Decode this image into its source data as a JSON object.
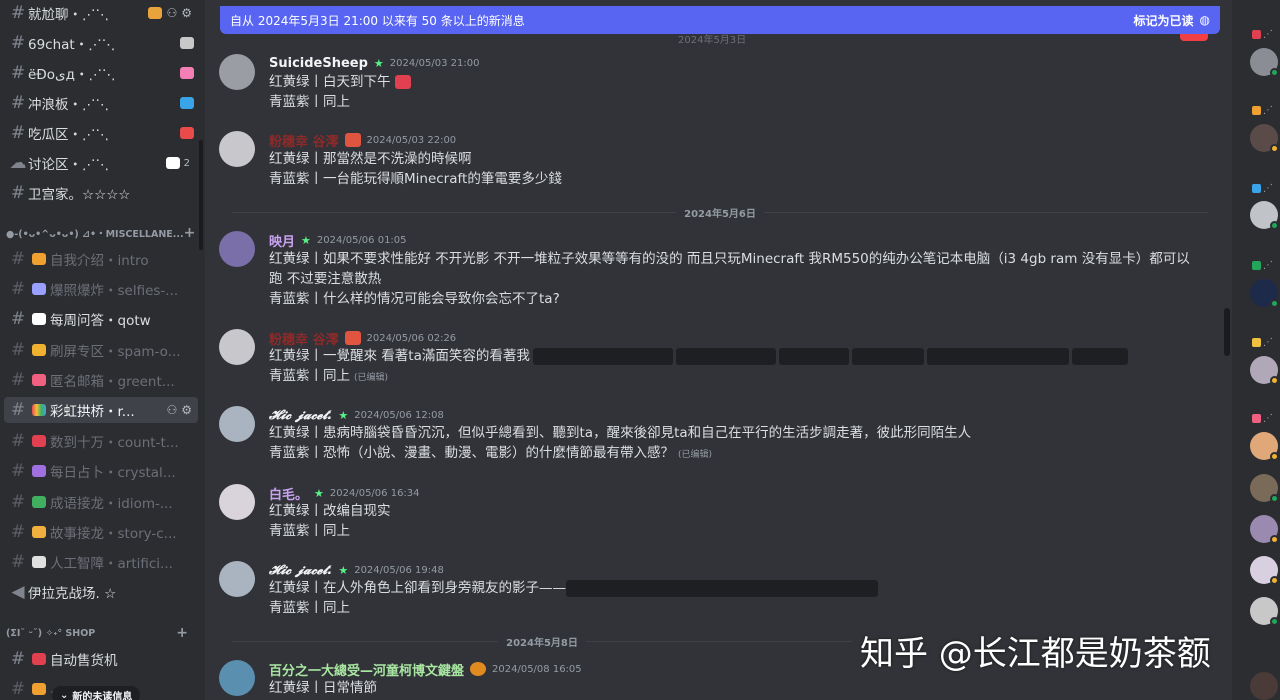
{
  "sidebar": {
    "channels": [
      {
        "name": "就尬聊・⋰⋱",
        "muted": false,
        "active": false,
        "emoji_color": "#e8a33c"
      },
      {
        "name": "69chat・⋰⋱",
        "muted": false,
        "active": false,
        "emoji_color": "#c8c8c8"
      },
      {
        "name": "ëĐoىд・⋰⋱",
        "muted": false,
        "active": false,
        "emoji_color": "#f47fb4"
      },
      {
        "name": "冲浪板・⋰⋱",
        "muted": false,
        "active": false,
        "emoji_color": "#3aa4e8"
      },
      {
        "name": "吃瓜区・⋰⋱",
        "muted": false,
        "active": false,
        "emoji_color": "#e94b4b"
      },
      {
        "name": "讨论区・⋰⋱",
        "muted": false,
        "active": false,
        "emoji_color": "#ffffff",
        "count": "2"
      },
      {
        "name": "卫宫家。☆☆☆☆",
        "muted": false,
        "active": false,
        "emoji_color": ""
      }
    ],
    "category_misc": "●-(•ᴗ•^ᴗ•ᴗ•) ⊿•・MISCELLANE...",
    "misc_channels": [
      {
        "name": "自我介绍・intro",
        "muted": true,
        "emoji_color": "#f0a030"
      },
      {
        "name": "爆照爆炸・selfies-...",
        "muted": true,
        "emoji_color": "#9aa0ff"
      },
      {
        "name": "每周问答・qotw",
        "muted": false,
        "emoji_color": "#ffffff"
      },
      {
        "name": "刷屏专区・spam-o...",
        "muted": true,
        "emoji_color": "#f0b030"
      },
      {
        "name": "匿名邮箱・greent...",
        "muted": true,
        "emoji_color": "#f06080"
      },
      {
        "name": "彩虹拱桥・r...",
        "muted": false,
        "active": true,
        "emoji_color": "#f0c040"
      },
      {
        "name": "数到十万・count-t...",
        "muted": true,
        "emoji_color": "#e04050"
      },
      {
        "name": "每日占卜・crystal...",
        "muted": true,
        "emoji_color": "#a070e0"
      },
      {
        "name": "成语接龙・idiom-...",
        "muted": true,
        "emoji_color": "#40b060"
      },
      {
        "name": "故事接龙・story-c...",
        "muted": true,
        "emoji_color": "#f0b040"
      },
      {
        "name": "人工智障・artifici...",
        "muted": true,
        "emoji_color": "#e0e0e0"
      },
      {
        "name": "伊拉克战场. ☆",
        "muted": false,
        "emoji_color": ""
      }
    ],
    "category_shop": "(ΣI˘ ᵕ˘) ✧˖° SHOP",
    "shop_channels": [
      {
        "name": "自动售货机",
        "muted": false,
        "emoji_color": "#e04050"
      },
      {
        "name": "...",
        "muted": true,
        "emoji_color": "#f0a030"
      }
    ],
    "new_unread": "新的未读信息"
  },
  "banner": {
    "text": "自从 2024年5月3日 21:00 以来有 50 条以上的新消息",
    "mark_read": "标记为已读",
    "ghost_date": "2024年5月3日"
  },
  "dividers": [
    "2024年5月6日",
    "2024年5月8日"
  ],
  "messages": [
    {
      "user": "SuicideSheep",
      "color": "#f2f3f5",
      "time": "2024/05/03 21:00",
      "avatar": "#9a9da3",
      "lines": [
        "红黄绿丨白天到下午",
        "青蓝紫丨同上"
      ]
    },
    {
      "user": "粉穗幸 谷澪",
      "color": "#8e2a2a",
      "time": "2024/05/03 22:00",
      "avatar": "#c8c8cc",
      "lines": [
        "红黄绿丨那當然是不洗澡的時候啊",
        "青蓝紫丨一台能玩得順Minecraft的筆電要多少錢"
      ]
    },
    {
      "user": "映月",
      "color": "#c9a3f2",
      "time": "2024/05/06 01:05",
      "avatar": "#7a6fa8",
      "lines": [
        "红黄绿丨如果不要求性能好 不开光影 不开一堆粒子效果等等有的没的 而且只玩Minecraft 我RM550的纯办公笔记本电脑（i3 4gb ram 没有显卡）都可以跑 不过要注意散热",
        "青蓝紫丨什么样的情况可能会导致你会忘不了ta?"
      ]
    },
    {
      "user": "粉穗幸 谷澪",
      "color": "#8e2a2a",
      "time": "2024/05/06 02:26",
      "avatar": "#c8c8cc",
      "lines": [
        "红黄绿丨一覺醒來 看著ta滿面笑容的看著我",
        "青蓝紫丨同上"
      ],
      "edited": "(已编辑)"
    },
    {
      "user": "𝓗𝓲𝓬 𝓳𝓪𝓬𝓮𝓽.",
      "color": "#f2f3f5",
      "time": "2024/05/06 12:08",
      "avatar": "#a9b4c0",
      "lines": [
        "红黄绿丨患病時腦袋昏昏沉沉，但似乎總看到、聽到ta，醒來後卻見ta和自己在平行的生活步調走著，彼此形同陌生人",
        "青蓝紫丨恐怖（小說、漫畫、動漫、電影）的什麼情節最有帶入感？"
      ],
      "edited": "(已编辑)"
    },
    {
      "user": "白毛。",
      "color": "#c9a3f2",
      "time": "2024/05/06 16:34",
      "avatar": "#d9d4dc",
      "lines": [
        "红黄绿丨改编自现实",
        "青蓝紫丨同上"
      ]
    },
    {
      "user": "𝓗𝓲𝓬 𝓳𝓪𝓬𝓮𝓽.",
      "color": "#f2f3f5",
      "time": "2024/05/06 19:48",
      "avatar": "#a9b4c0",
      "lines": [
        "红黄绿丨在人外角色上卻看到身旁親友的影子——",
        "青蓝紫丨同上"
      ]
    },
    {
      "user": "百分之一大總受—河童柯博文鍵盤",
      "color": "#a8e6a1",
      "time": "2024/05/08 16:05",
      "avatar": "#5a8fb0",
      "lines": [
        "红黄绿丨日常情節"
      ]
    }
  ],
  "watermark": "知乎 @长江都是奶茶额",
  "colors": {
    "accent": "#5865f2",
    "bg": "#313338",
    "sidebar": "#2b2d31"
  }
}
